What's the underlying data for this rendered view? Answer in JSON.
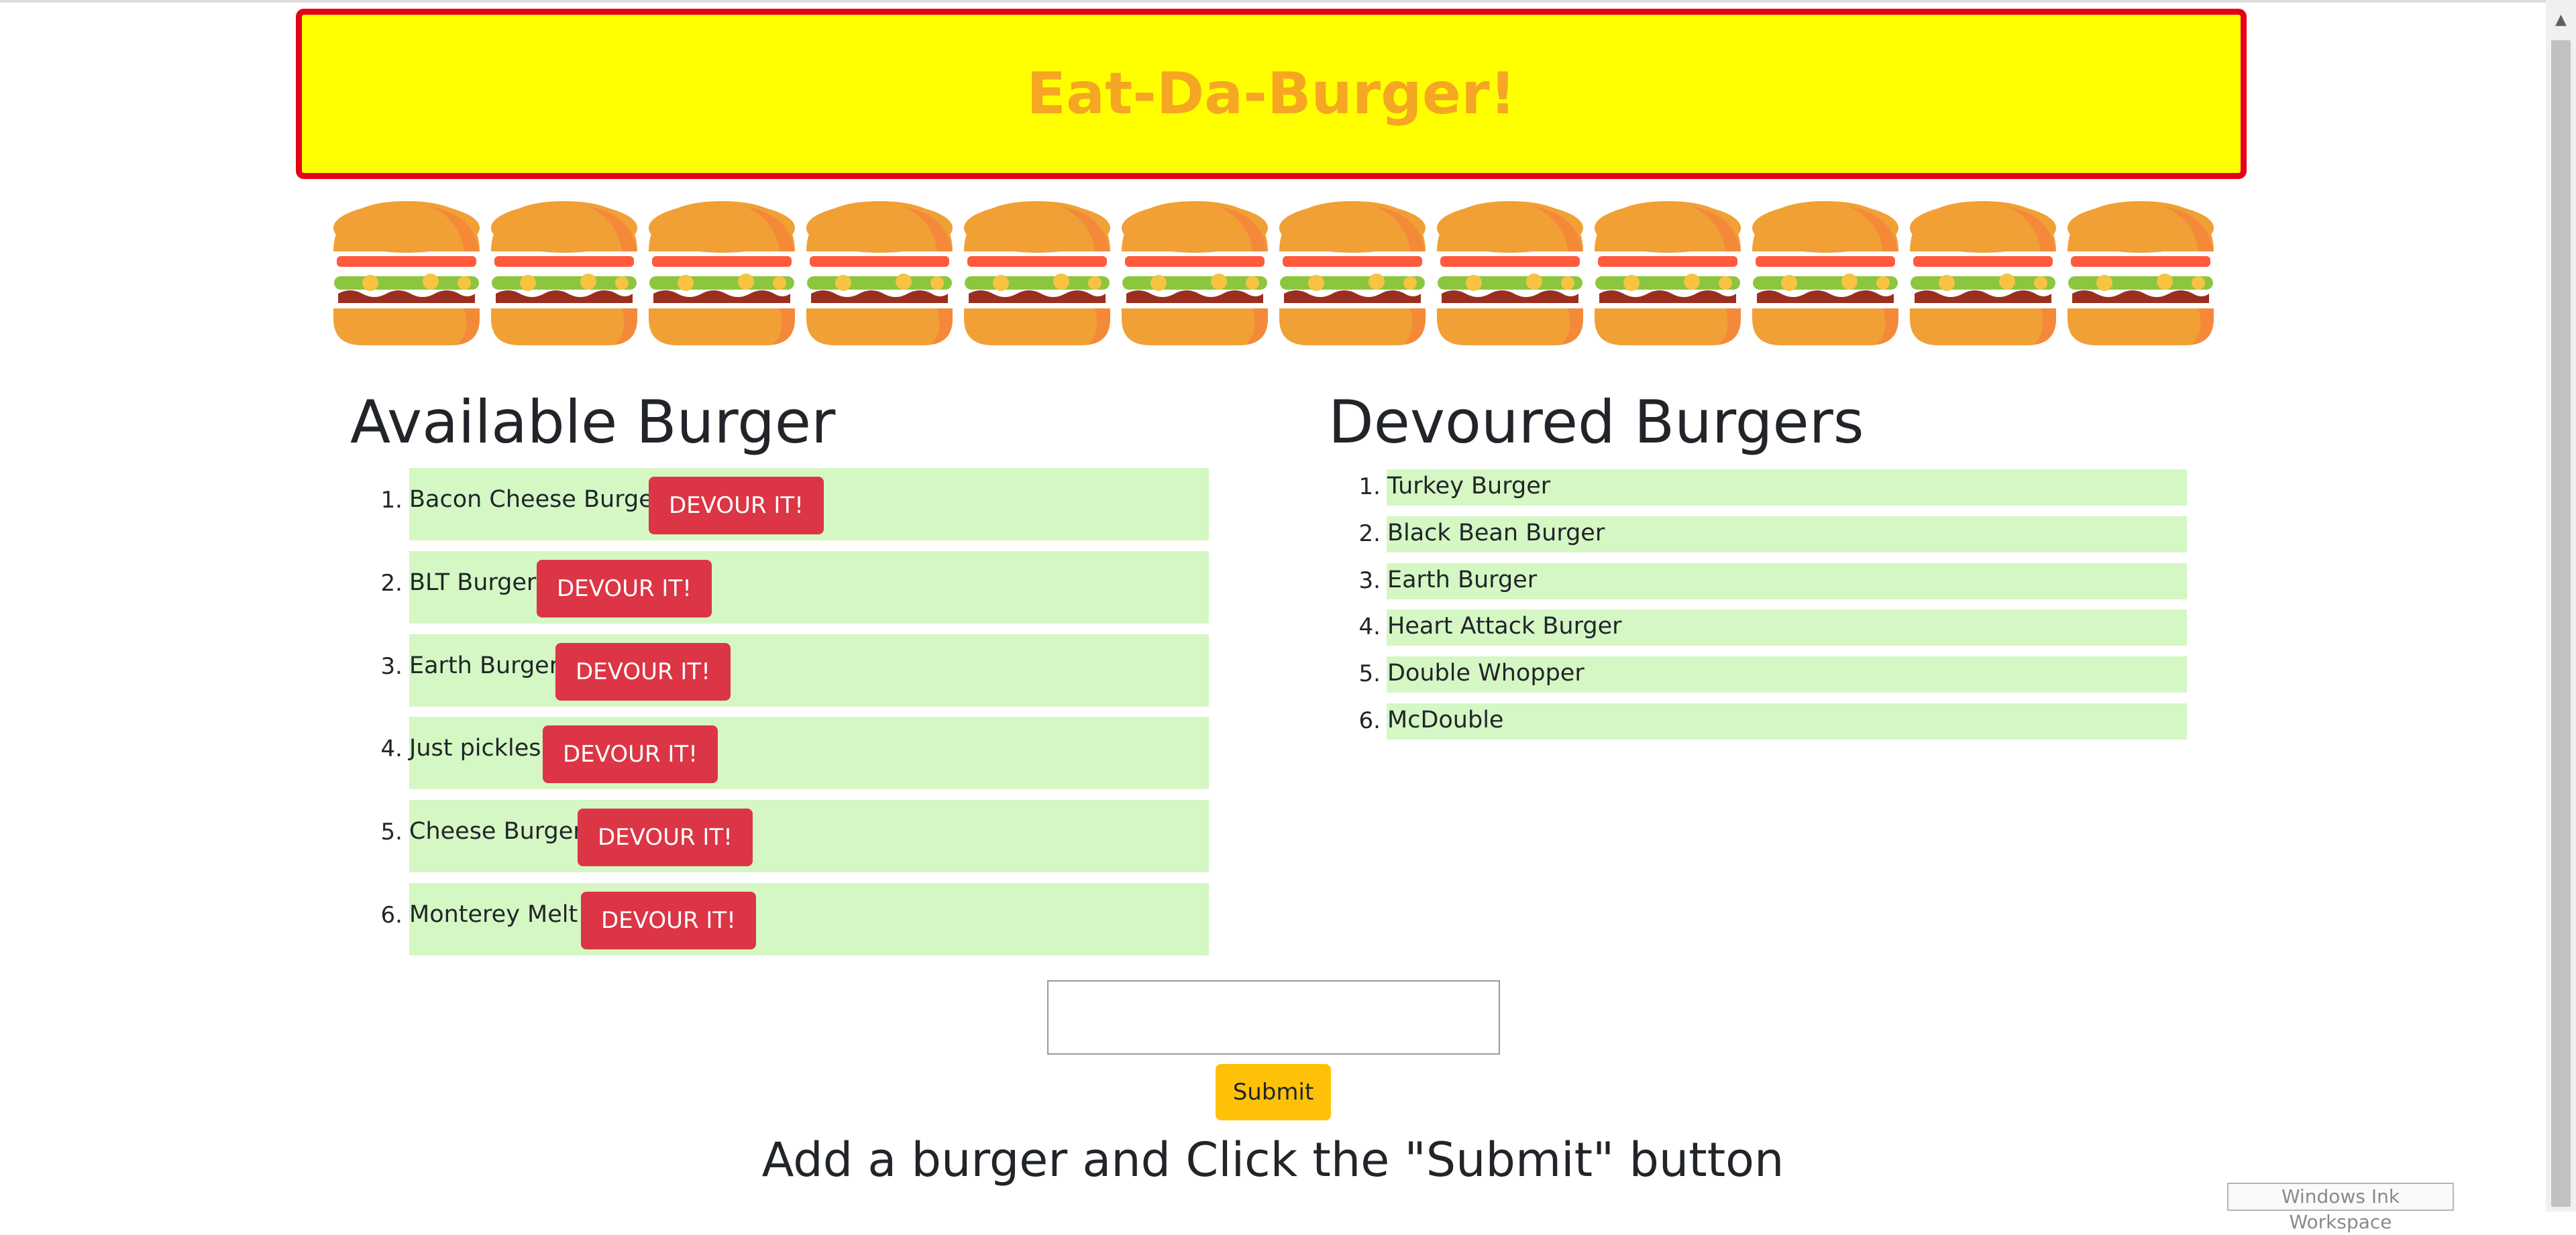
{
  "header": {
    "title": "Eat-Da-Burger!"
  },
  "burger_banner": {
    "count": 12,
    "icon": "burger-icon"
  },
  "available": {
    "title": "Available Burger",
    "button_label": "DEVOUR IT!",
    "items": [
      {
        "num": "1.",
        "name": "Bacon Cheese Burger"
      },
      {
        "num": "2.",
        "name": "BLT Burger"
      },
      {
        "num": "3.",
        "name": "Earth Burger"
      },
      {
        "num": "4.",
        "name": "Just pickles"
      },
      {
        "num": "5.",
        "name": "Cheese Burger"
      },
      {
        "num": "6.",
        "name": "Monterey Melt"
      }
    ]
  },
  "devoured": {
    "title": "Devoured Burgers",
    "items": [
      {
        "num": "1.",
        "name": "Turkey Burger"
      },
      {
        "num": "2.",
        "name": "Black Bean Burger"
      },
      {
        "num": "3.",
        "name": "Earth Burger"
      },
      {
        "num": "4.",
        "name": "Heart Attack Burger"
      },
      {
        "num": "5.",
        "name": "Double Whopper"
      },
      {
        "num": "6.",
        "name": "McDouble"
      }
    ]
  },
  "form": {
    "input_value": "",
    "submit_label": "Submit",
    "instruction": "Add a burger and Click the \"Submit\" button"
  },
  "overlay": {
    "ink_workspace": "Windows Ink Workspace"
  },
  "colors": {
    "banner_bg": "#ffff00",
    "banner_border": "#e3001b",
    "title": "#f5a623",
    "item_bg": "#d4f7c4",
    "devour_button": "#dc3545",
    "submit_button": "#ffc107"
  }
}
